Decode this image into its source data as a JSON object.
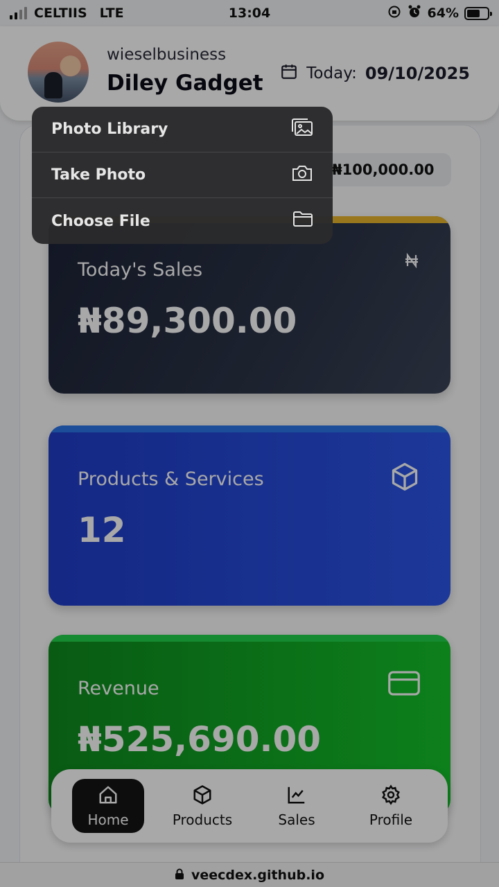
{
  "status_bar": {
    "carrier": "CELTIIS",
    "network": "LTE",
    "time": "13:04",
    "battery": "64%",
    "battery_level": 0.64
  },
  "header": {
    "business_handle": "wieselbusiness",
    "business_name": "Diley Gadget",
    "today_label": "Today:",
    "today_date": "09/10/2025"
  },
  "balance": {
    "amount": "₦100,000.00"
  },
  "cards": {
    "sales": {
      "label": "Today's Sales",
      "value": "₦89,300.00",
      "icon": "naira-icon",
      "accent": "#e8b62c"
    },
    "products": {
      "label": "Products & Services",
      "value": "12",
      "icon": "cube-icon",
      "accent": "#2a76e8"
    },
    "revenue": {
      "label": "Revenue",
      "value": "₦525,690.00",
      "icon": "credit-card-icon",
      "accent": "#22d24a"
    }
  },
  "nav": {
    "items": [
      {
        "label": "Home",
        "icon": "home-icon",
        "active": true
      },
      {
        "label": "Products",
        "icon": "cube-icon",
        "active": false
      },
      {
        "label": "Sales",
        "icon": "chart-line-icon",
        "active": false
      },
      {
        "label": "Profile",
        "icon": "gear-icon",
        "active": false
      }
    ]
  },
  "menu": {
    "items": [
      {
        "label": "Photo Library",
        "icon": "photo-library-icon"
      },
      {
        "label": "Take Photo",
        "icon": "camera-icon"
      },
      {
        "label": "Choose File",
        "icon": "folder-icon"
      }
    ]
  },
  "url_bar": {
    "url": "veecdex.github.io"
  }
}
